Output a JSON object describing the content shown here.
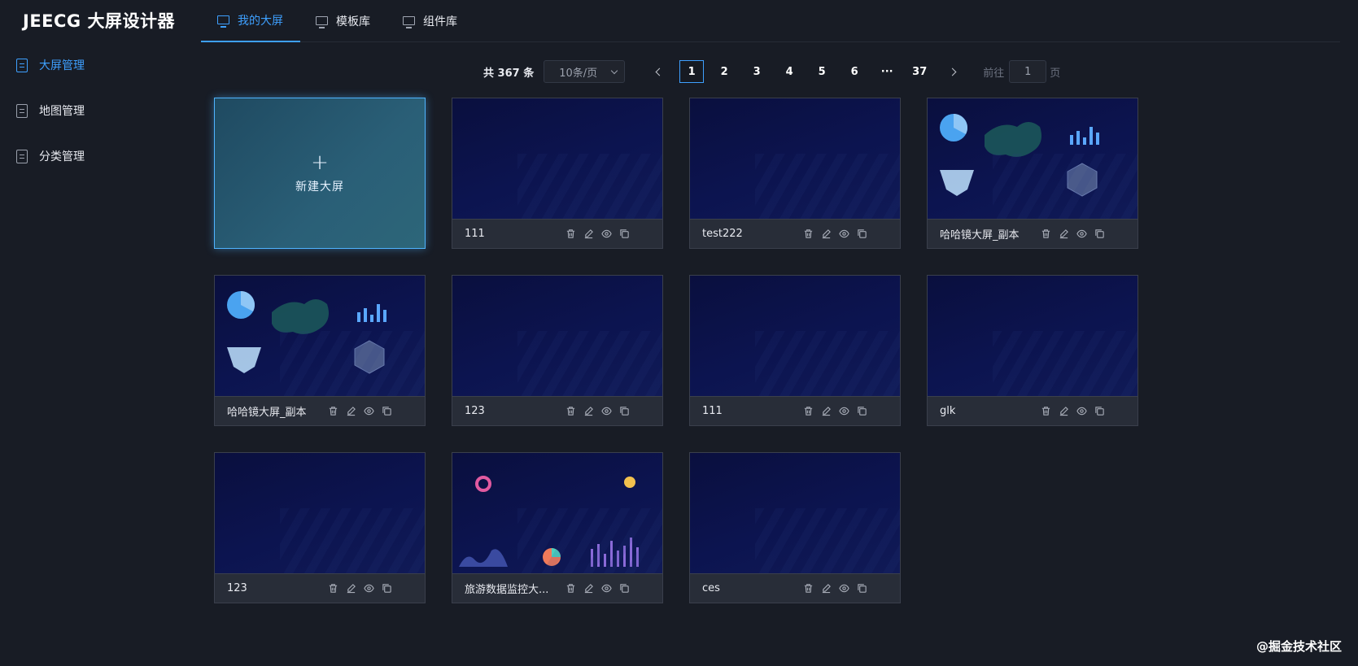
{
  "app": {
    "title": "JEECG 大屏设计器"
  },
  "sidebar": {
    "items": [
      {
        "label": "大屏管理",
        "icon": "document-icon",
        "active": true
      },
      {
        "label": "地图管理",
        "icon": "document-icon",
        "active": false
      },
      {
        "label": "分类管理",
        "icon": "document-icon",
        "active": false
      }
    ]
  },
  "tabs": [
    {
      "label": "我的大屏",
      "icon": "monitor-icon",
      "active": true
    },
    {
      "label": "模板库",
      "icon": "monitor-icon",
      "active": false
    },
    {
      "label": "组件库",
      "icon": "monitor-icon",
      "active": false
    }
  ],
  "pagination": {
    "total_label": "共 367 条",
    "page_size": "10条/页",
    "pages": [
      "1",
      "2",
      "3",
      "4",
      "5",
      "6",
      "···",
      "37"
    ],
    "current": "1",
    "goto_prefix": "前往",
    "goto_value": "1",
    "goto_suffix": "页"
  },
  "new_screen": {
    "plus": "+",
    "label": "新建大屏"
  },
  "cards": [
    {
      "name": "111",
      "thumbnail": "blank"
    },
    {
      "name": "test222",
      "thumbnail": "blank"
    },
    {
      "name": "哈哈镜大屏_副本",
      "thumbnail": "map-dashboard"
    },
    {
      "name": "哈哈镜大屏_副本",
      "thumbnail": "map-dashboard"
    },
    {
      "name": "123",
      "thumbnail": "blank"
    },
    {
      "name": "111",
      "thumbnail": "blank"
    },
    {
      "name": "glk",
      "thumbnail": "blank"
    },
    {
      "name": "123",
      "thumbnail": "blank"
    },
    {
      "name": "旅游数据监控大...",
      "thumbnail": "tourism-dashboard"
    },
    {
      "name": "ces",
      "thumbnail": "blank"
    }
  ],
  "card_actions": [
    "delete-icon",
    "edit-icon",
    "preview-icon",
    "copy-icon"
  ],
  "watermark": "@掘金技术社区",
  "colors": {
    "accent": "#3ea0ff",
    "background": "#181c25",
    "card_bar": "#282d38"
  }
}
